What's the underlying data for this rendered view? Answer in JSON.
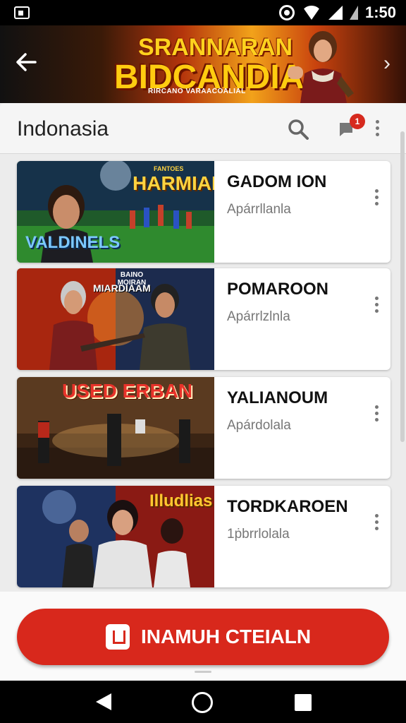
{
  "status_bar": {
    "time": "1:50"
  },
  "banner": {
    "title_line1": "SRANNARAN",
    "title_line2": "BIDCANDIA",
    "subtitle": "RIRCANO VARAACOALIAL"
  },
  "app_bar": {
    "title": "Indonasia",
    "notification_count": "1"
  },
  "cards": [
    {
      "thumb_title": "HARMIAN",
      "thumb_small": "FANTOES",
      "thumb_caption": "VALDINELS",
      "name": "GADOM ION",
      "subtitle": "Apárrllanla"
    },
    {
      "thumb_title": "MIARDIAAM",
      "thumb_small": "BAINO MOIRAN",
      "thumb_caption": "",
      "name": "POMAROON",
      "subtitle": "Apárrlzlnla"
    },
    {
      "thumb_title": "USED ERBAN",
      "thumb_small": "",
      "thumb_caption": "",
      "name": "YALIANOUM",
      "subtitle": "Apárdolala"
    },
    {
      "thumb_title": "Illudlias",
      "thumb_small": "",
      "thumb_caption": "",
      "name": "TORDKAROEN",
      "subtitle": "1ṗbrrlolala"
    }
  ],
  "cta": {
    "label": "INAMUH CTEIALN"
  },
  "colors": {
    "accent": "#d8281c",
    "banner_gold": "#ffcc10"
  },
  "icons": [
    "back-arrow-icon",
    "search-icon",
    "chat-icon",
    "more-vert-icon",
    "lock-icon",
    "nav-back-icon",
    "nav-home-icon",
    "nav-recents-icon"
  ]
}
